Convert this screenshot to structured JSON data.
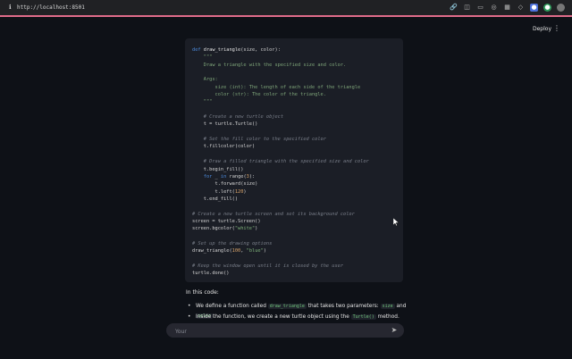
{
  "browser": {
    "url": "http://localhost:8501"
  },
  "header": {
    "deploy_label": "Deploy",
    "menu_glyph": "⋮"
  },
  "code_lines": [
    [
      {
        "t": "def ",
        "c": "kw"
      },
      {
        "t": "draw_triangle",
        "c": "fn"
      },
      {
        "t": "(size, color):",
        "c": ""
      }
    ],
    [
      {
        "t": "    \"\"\"",
        "c": "doc"
      }
    ],
    [
      {
        "t": "    Draw a triangle with the specified size and color.",
        "c": "doc"
      }
    ],
    [
      {
        "t": "",
        "c": ""
      }
    ],
    [
      {
        "t": "    Args:",
        "c": "doc"
      }
    ],
    [
      {
        "t": "        size (int): The length of each side of the triangle",
        "c": "doc"
      }
    ],
    [
      {
        "t": "        color (str): The color of the triangle.",
        "c": "doc"
      }
    ],
    [
      {
        "t": "    \"\"\"",
        "c": "doc"
      }
    ],
    [
      {
        "t": "",
        "c": ""
      }
    ],
    [
      {
        "t": "    # Create a new turtle object",
        "c": "cm"
      }
    ],
    [
      {
        "t": "    t = turtle.Turtle()",
        "c": ""
      }
    ],
    [
      {
        "t": "",
        "c": ""
      }
    ],
    [
      {
        "t": "    # Set the fill color to the specified color",
        "c": "cm"
      }
    ],
    [
      {
        "t": "    t.fillcolor(color)",
        "c": ""
      }
    ],
    [
      {
        "t": "",
        "c": ""
      }
    ],
    [
      {
        "t": "    # Draw a filled triangle with the specified size and color",
        "c": "cm"
      }
    ],
    [
      {
        "t": "    t.begin_fill()",
        "c": ""
      }
    ],
    [
      {
        "t": "    ",
        "c": ""
      },
      {
        "t": "for",
        "c": "kw"
      },
      {
        "t": " _ ",
        "c": ""
      },
      {
        "t": "in",
        "c": "kw"
      },
      {
        "t": " range(",
        "c": ""
      },
      {
        "t": "3",
        "c": "num"
      },
      {
        "t": "):",
        "c": ""
      }
    ],
    [
      {
        "t": "        t.forward(size)",
        "c": ""
      }
    ],
    [
      {
        "t": "        t.left(",
        "c": ""
      },
      {
        "t": "120",
        "c": "num"
      },
      {
        "t": ")",
        "c": ""
      }
    ],
    [
      {
        "t": "    t.end_fill()",
        "c": ""
      }
    ],
    [
      {
        "t": "",
        "c": ""
      }
    ],
    [
      {
        "t": "# Create a new turtle screen and set its background color",
        "c": "cm"
      }
    ],
    [
      {
        "t": "screen = turtle.Screen()",
        "c": ""
      }
    ],
    [
      {
        "t": "screen.bgcolor(",
        "c": ""
      },
      {
        "t": "\"white\"",
        "c": "str"
      },
      {
        "t": ")",
        "c": ""
      }
    ],
    [
      {
        "t": "",
        "c": ""
      }
    ],
    [
      {
        "t": "# Set up the drawing options",
        "c": "cm"
      }
    ],
    [
      {
        "t": "draw_triangle(",
        "c": ""
      },
      {
        "t": "100",
        "c": "num"
      },
      {
        "t": ", ",
        "c": ""
      },
      {
        "t": "\"blue\"",
        "c": "str"
      },
      {
        "t": ")",
        "c": ""
      }
    ],
    [
      {
        "t": "",
        "c": ""
      }
    ],
    [
      {
        "t": "# Keep the window open until it is closed by the user",
        "c": "cm"
      }
    ],
    [
      {
        "t": "turtle.done()",
        "c": ""
      }
    ]
  ],
  "explanation": {
    "intro": "In this code:",
    "bullet1": {
      "pre": "We define a function called ",
      "code1": "draw_triangle",
      "mid": " that takes two parameters: ",
      "code2": "size",
      "and": " and ",
      "code3": "color",
      "post": "."
    },
    "bullet2": {
      "pre": "Inside the function, we create a new turtle object using the ",
      "code1": "Turtle()",
      "post": " method."
    }
  },
  "chat": {
    "placeholder": "Your"
  },
  "colors": {
    "background": "#0e1117",
    "code_bg": "#1b1e26",
    "accent_line": "#e06c8a",
    "keyword": "#4d8de0",
    "inline_code": "#6fc47b"
  }
}
